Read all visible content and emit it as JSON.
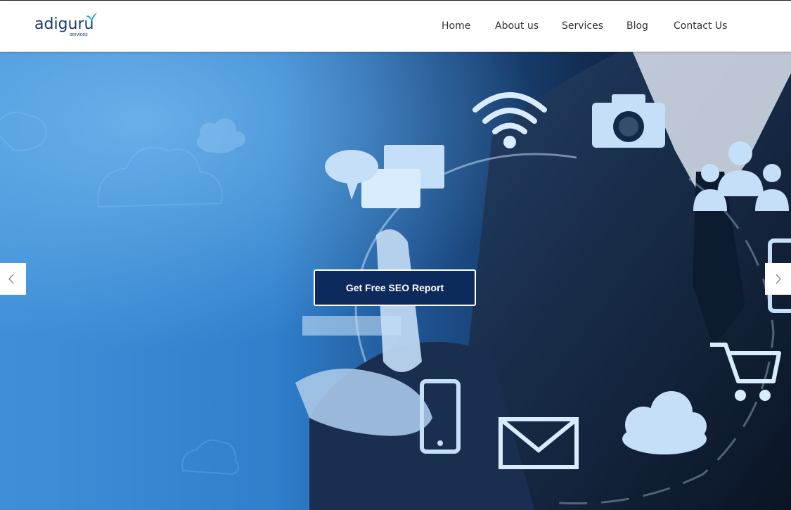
{
  "brand": {
    "name": "adiguru",
    "subtitle": "services"
  },
  "nav": {
    "items": [
      {
        "label": "Home"
      },
      {
        "label": "About us"
      },
      {
        "label": "Services"
      },
      {
        "label": "Blog"
      },
      {
        "label": "Contact Us"
      }
    ]
  },
  "hero": {
    "cta_label": "Get Free SEO Report",
    "prev_icon": "chevron-left-icon",
    "next_icon": "chevron-right-icon"
  },
  "colors": {
    "brand": "#1b3a6b",
    "accent": "#29a8e0",
    "cta_bg": "#0c2a5b"
  }
}
